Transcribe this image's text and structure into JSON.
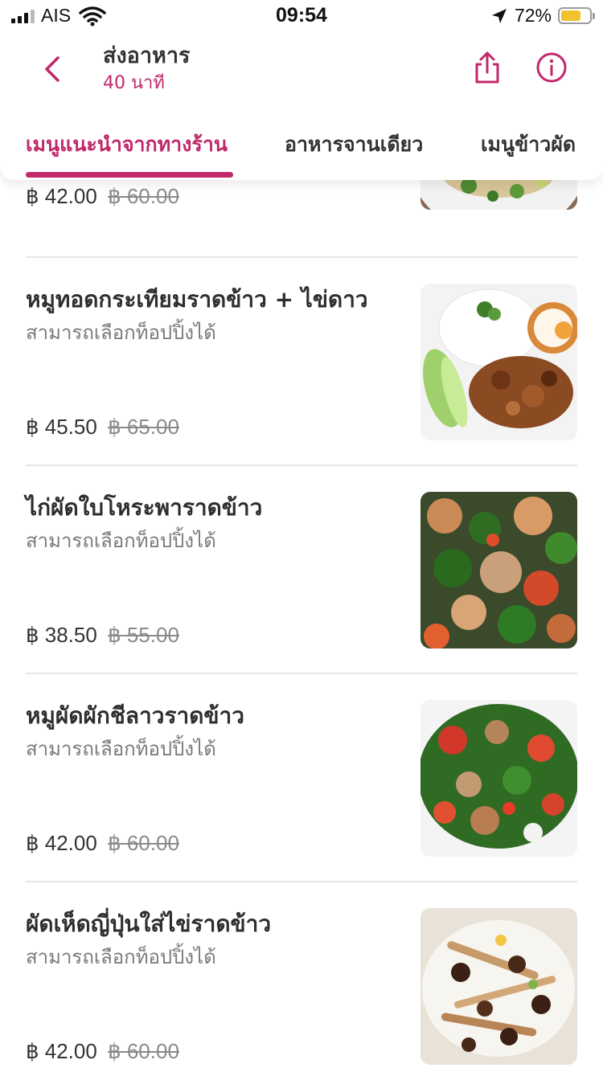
{
  "status_bar": {
    "carrier": "AIS",
    "time": "09:54",
    "battery_percent": "72%",
    "battery_level": 0.72,
    "icons": [
      "signal-icon",
      "wifi-icon",
      "location-arrow-icon",
      "battery-icon"
    ]
  },
  "header": {
    "title": "ส่งอาหาร",
    "subtitle": "40 นาที",
    "icons": [
      "back-chevron-icon",
      "share-icon",
      "info-icon"
    ]
  },
  "tabs": [
    {
      "label": "เมนูแนะนำจากทางร้าน",
      "active": true
    },
    {
      "label": "อาหารจานเดียว",
      "active": false
    },
    {
      "label": "เมนูข้าวผัด",
      "active": false
    }
  ],
  "colors": {
    "accent": "#c0286a",
    "text": "#2e2e2e",
    "muted": "#7a7a7a",
    "divider": "#e6e6e6"
  },
  "menu_items": [
    {
      "name": "",
      "desc": "",
      "price": "฿ 42.00",
      "old_price": "฿ 60.00",
      "image": "food-photo"
    },
    {
      "name": "หมูทอดกระเทียมราดข้าว + ไข่ดาว",
      "desc": "สามารถเลือกท็อปปิ้งได้",
      "price": "฿ 45.50",
      "old_price": "฿ 65.00",
      "image": "food-photo"
    },
    {
      "name": "ไก่ผัดใบโหระพาราดข้าว",
      "desc": "สามารถเลือกท็อปปิ้งได้",
      "price": "฿ 38.50",
      "old_price": "฿ 55.00",
      "image": "food-photo"
    },
    {
      "name": "หมูผัดผักชีลาวราดข้าว",
      "desc": "สามารถเลือกท็อปปิ้งได้",
      "price": "฿ 42.00",
      "old_price": "฿ 60.00",
      "image": "food-photo"
    },
    {
      "name": "ผัดเห็ดญี่ปุ่นใส่ไข่ราดข้าว",
      "desc": "สามารถเลือกท็อปปิ้งได้",
      "price": "฿ 42.00",
      "old_price": "฿ 60.00",
      "image": "food-photo"
    }
  ]
}
